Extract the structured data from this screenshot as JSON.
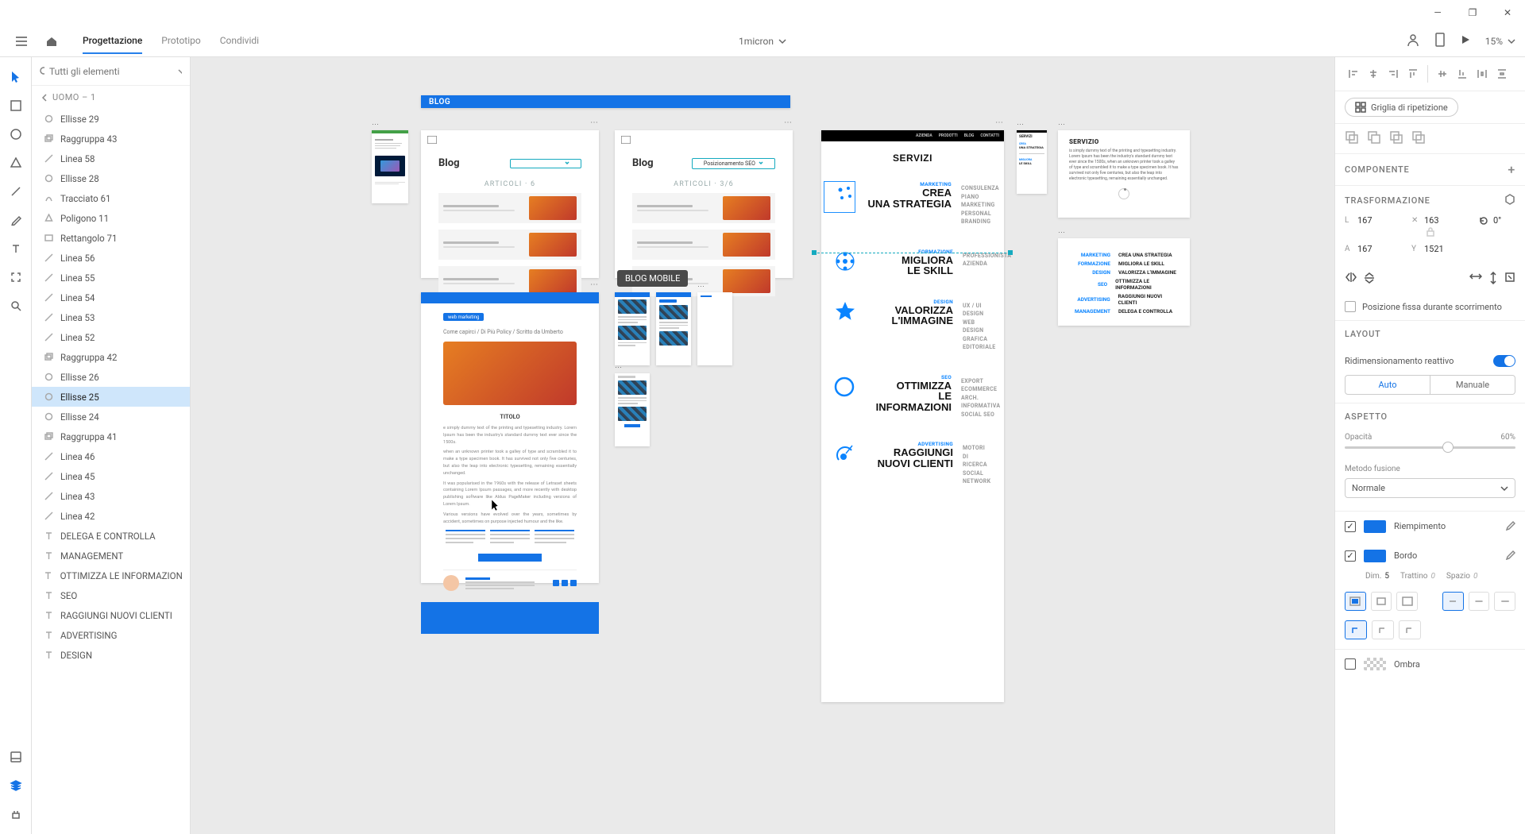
{
  "titlebar": {
    "min": "—",
    "max": "❐",
    "close": "✕"
  },
  "menu": {
    "design": "Progettazione",
    "prototype": "Prototipo",
    "share": "Condividi",
    "doc_name": "1micron",
    "zoom": "15%"
  },
  "layers": {
    "search_placeholder": "Tutti gli elementi",
    "crumb": "UOMO – 1",
    "items": [
      {
        "icon": "ellipse",
        "name": "Ellisse 29"
      },
      {
        "icon": "group",
        "name": "Raggruppa 43"
      },
      {
        "icon": "line",
        "name": "Linea 58"
      },
      {
        "icon": "ellipse",
        "name": "Ellisse 28"
      },
      {
        "icon": "path",
        "name": "Tracciato 61"
      },
      {
        "icon": "polygon",
        "name": "Poligono 11"
      },
      {
        "icon": "rect",
        "name": "Rettangolo 71"
      },
      {
        "icon": "line",
        "name": "Linea 56"
      },
      {
        "icon": "line",
        "name": "Linea 55"
      },
      {
        "icon": "line",
        "name": "Linea 54"
      },
      {
        "icon": "line",
        "name": "Linea 53"
      },
      {
        "icon": "line",
        "name": "Linea 52"
      },
      {
        "icon": "group",
        "name": "Raggruppa 42"
      },
      {
        "icon": "ellipse",
        "name": "Ellisse 26"
      },
      {
        "icon": "ellipse",
        "name": "Ellisse 25",
        "selected": true
      },
      {
        "icon": "ellipse",
        "name": "Ellisse 24"
      },
      {
        "icon": "group",
        "name": "Raggruppa 41"
      },
      {
        "icon": "line",
        "name": "Linea 46"
      },
      {
        "icon": "line",
        "name": "Linea 45"
      },
      {
        "icon": "line",
        "name": "Linea 43"
      },
      {
        "icon": "line",
        "name": "Linea 42"
      },
      {
        "icon": "text",
        "name": "DELEGA E CONTROLLA"
      },
      {
        "icon": "text",
        "name": "MANAGEMENT"
      },
      {
        "icon": "text",
        "name": "OTTIMIZZA LE INFORMAZIONI"
      },
      {
        "icon": "text",
        "name": "SEO"
      },
      {
        "icon": "text",
        "name": "RAGGIUNGI NUOVI CLIENTI"
      },
      {
        "icon": "text",
        "name": "ADVERTISING"
      },
      {
        "icon": "text",
        "name": "DESIGN"
      }
    ]
  },
  "canvas": {
    "blog_header": "BLOG",
    "blog_title": "Blog",
    "blog_pill_2": "Posizionamento SEO",
    "articoli_label": "ARTICOLI · 6",
    "articoli_label_2": "ARTICOLI · 3/6",
    "tooltip": "BLOG MOBILE",
    "article_tag": "web marketing",
    "article_crumbs": "Come capirci / Di Più Policy / Scritto da Umberto",
    "servizi": {
      "title": "SERVIZI",
      "rows": [
        {
          "cat": "MARKETING",
          "line1": "CREA",
          "line2": "UNA STRATEGIA",
          "items": [
            "CONSULENZA",
            "PIANO MARKETING",
            "PERSONAL BRANDING"
          ]
        },
        {
          "cat": "FORMAZIONE",
          "line1": "MIGLIORA",
          "line2": "LE SKILL",
          "items": [
            "PROFESSIONISTA",
            "AZIENDA"
          ]
        },
        {
          "cat": "DESIGN",
          "line1": "VALORIZZA",
          "line2": "L'IMMAGINE",
          "items": [
            "UX / UI DESIGN",
            "WEB DESIGN",
            "GRAFICA EDITORIALE"
          ]
        },
        {
          "cat": "SEO",
          "line1": "OTTIMIZZA",
          "line2": "LE INFORMAZIONI",
          "items": [
            "EXPORT",
            "ECOMMERCE",
            "ARCH. INFORMATIVA",
            "SOCIAL SEO"
          ]
        },
        {
          "cat": "ADVERTISING",
          "line1": "RAGGIUNGI",
          "line2": "NUOVI CLIENTI",
          "items": [
            "MOTORI DI RICERCA",
            "SOCIAL NETWORK"
          ]
        }
      ],
      "nav": [
        "AZIENDA",
        "PRODOTTI",
        "BLOG",
        "CONTATTI"
      ]
    },
    "mini_servizio_title": "SERVIZIO",
    "mini_servizio_text": "is simply dummy text of the printing and typesetting industry. Lorem Ipsum has been the industry's standard dummy text ever since the 1500s, when an unknown printer took a galley of type and scrambled it to make a type specimen book. It has survived not only five centuries, but also the leap into electronic typesetting, remaining essentially unchanged.",
    "mini_list": [
      {
        "l": "MARKETING",
        "r": "CREA UNA STRATEGIA"
      },
      {
        "l": "FORMAZIONE",
        "r": "MIGLIORA LE SKILL"
      },
      {
        "l": "DESIGN",
        "r": "VALORIZZA L'IMMAGINE"
      },
      {
        "l": "SEO",
        "r": "OTTIMIZZA LE INFORMAZIONI"
      },
      {
        "l": "ADVERTISING",
        "r": "RAGGIUNGI NUOVI CLIENTI"
      },
      {
        "l": "MANAGEMENT",
        "r": "DELEGA E CONTROLLA"
      }
    ],
    "mini_servizi_title": "SERVIZI",
    "mini_crea": {
      "cat": "CREA",
      "line": "UNA STRATEGIA"
    },
    "mini_migliora": {
      "cat": "MIGLIORA",
      "line": "LE SKILL"
    }
  },
  "inspector": {
    "repeat_grid": "Griglia di ripetizione",
    "component_h": "COMPONENTE",
    "transform_h": "TRASFORMAZIONE",
    "L": "167",
    "l_label": "L",
    "W": "163",
    "w_label": "",
    "rot": "0°",
    "A": "167",
    "a_label": "A",
    "Y": "1521",
    "y_label": "Y",
    "fixed_scroll": "Posizione fissa durante scorrimento",
    "layout_h": "LAYOUT",
    "responsive": "Ridimensionamento reattivo",
    "auto": "Auto",
    "manual": "Manuale",
    "aspect_h": "ASPETTO",
    "opacity_l": "Opacità",
    "opacity_v": "60%",
    "blend_l": "Metodo fusione",
    "blend_v": "Normale",
    "fill": "Riempimento",
    "border": "Bordo",
    "dim_l": "Dim.",
    "dim_v": "5",
    "dash_l": "Trattino",
    "dash_v": "0",
    "gap_l": "Spazio",
    "gap_v": "0",
    "shadow": "Ombra"
  }
}
